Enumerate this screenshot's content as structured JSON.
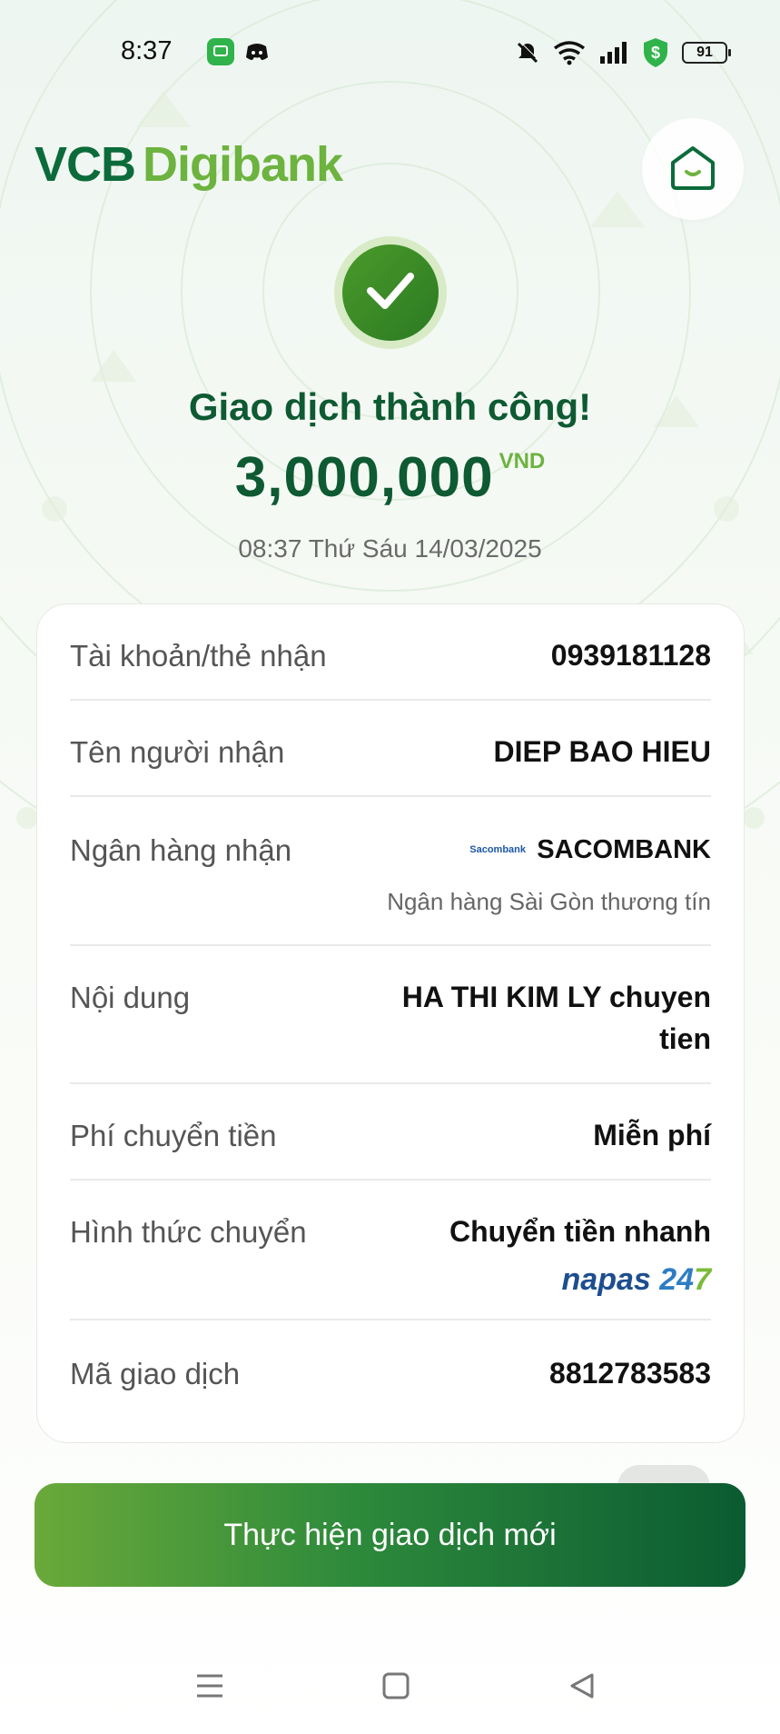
{
  "status_bar": {
    "time": "8:37",
    "battery": "91",
    "icons": [
      "messages-app-icon",
      "discord-icon",
      "bell-muted-icon",
      "wifi-icon",
      "signal-icon",
      "shield-dollar-icon",
      "battery-icon"
    ]
  },
  "header": {
    "logo_part1": "VCB",
    "logo_part2": "Digibank",
    "home_icon": "home-icon"
  },
  "result": {
    "title": "Giao dịch thành công!",
    "amount": "3,000,000",
    "currency": "VND",
    "datetime": "08:37 Thứ Sáu 14/03/2025"
  },
  "details": {
    "account_label": "Tài khoản/thẻ nhận",
    "account_value": "0939181128",
    "recipient_label": "Tên người nhận",
    "recipient_value": "DIEP BAO HIEU",
    "bank_label": "Ngân hàng nhận",
    "bank_logo_text": "Sacombank",
    "bank_value": "SACOMBANK",
    "bank_full": "Ngân hàng Sài Gòn thương tín",
    "content_label": "Nội dung",
    "content_line1": "HA THI KIM LY chuyen",
    "content_line2": "tien",
    "fee_label": "Phí chuyển tiền",
    "fee_value": "Miễn phí",
    "method_label": "Hình thức chuyển",
    "method_value": "Chuyển tiền nhanh",
    "napas_1": "napas",
    "napas_2": "24",
    "napas_3": "7",
    "txn_label": "Mã giao dịch",
    "txn_value": "8812783583"
  },
  "actions": {
    "new_transaction": "Thực hiện giao dịch mới"
  },
  "colors": {
    "brand_dark": "#0e5a32",
    "brand_light": "#6db33f"
  }
}
